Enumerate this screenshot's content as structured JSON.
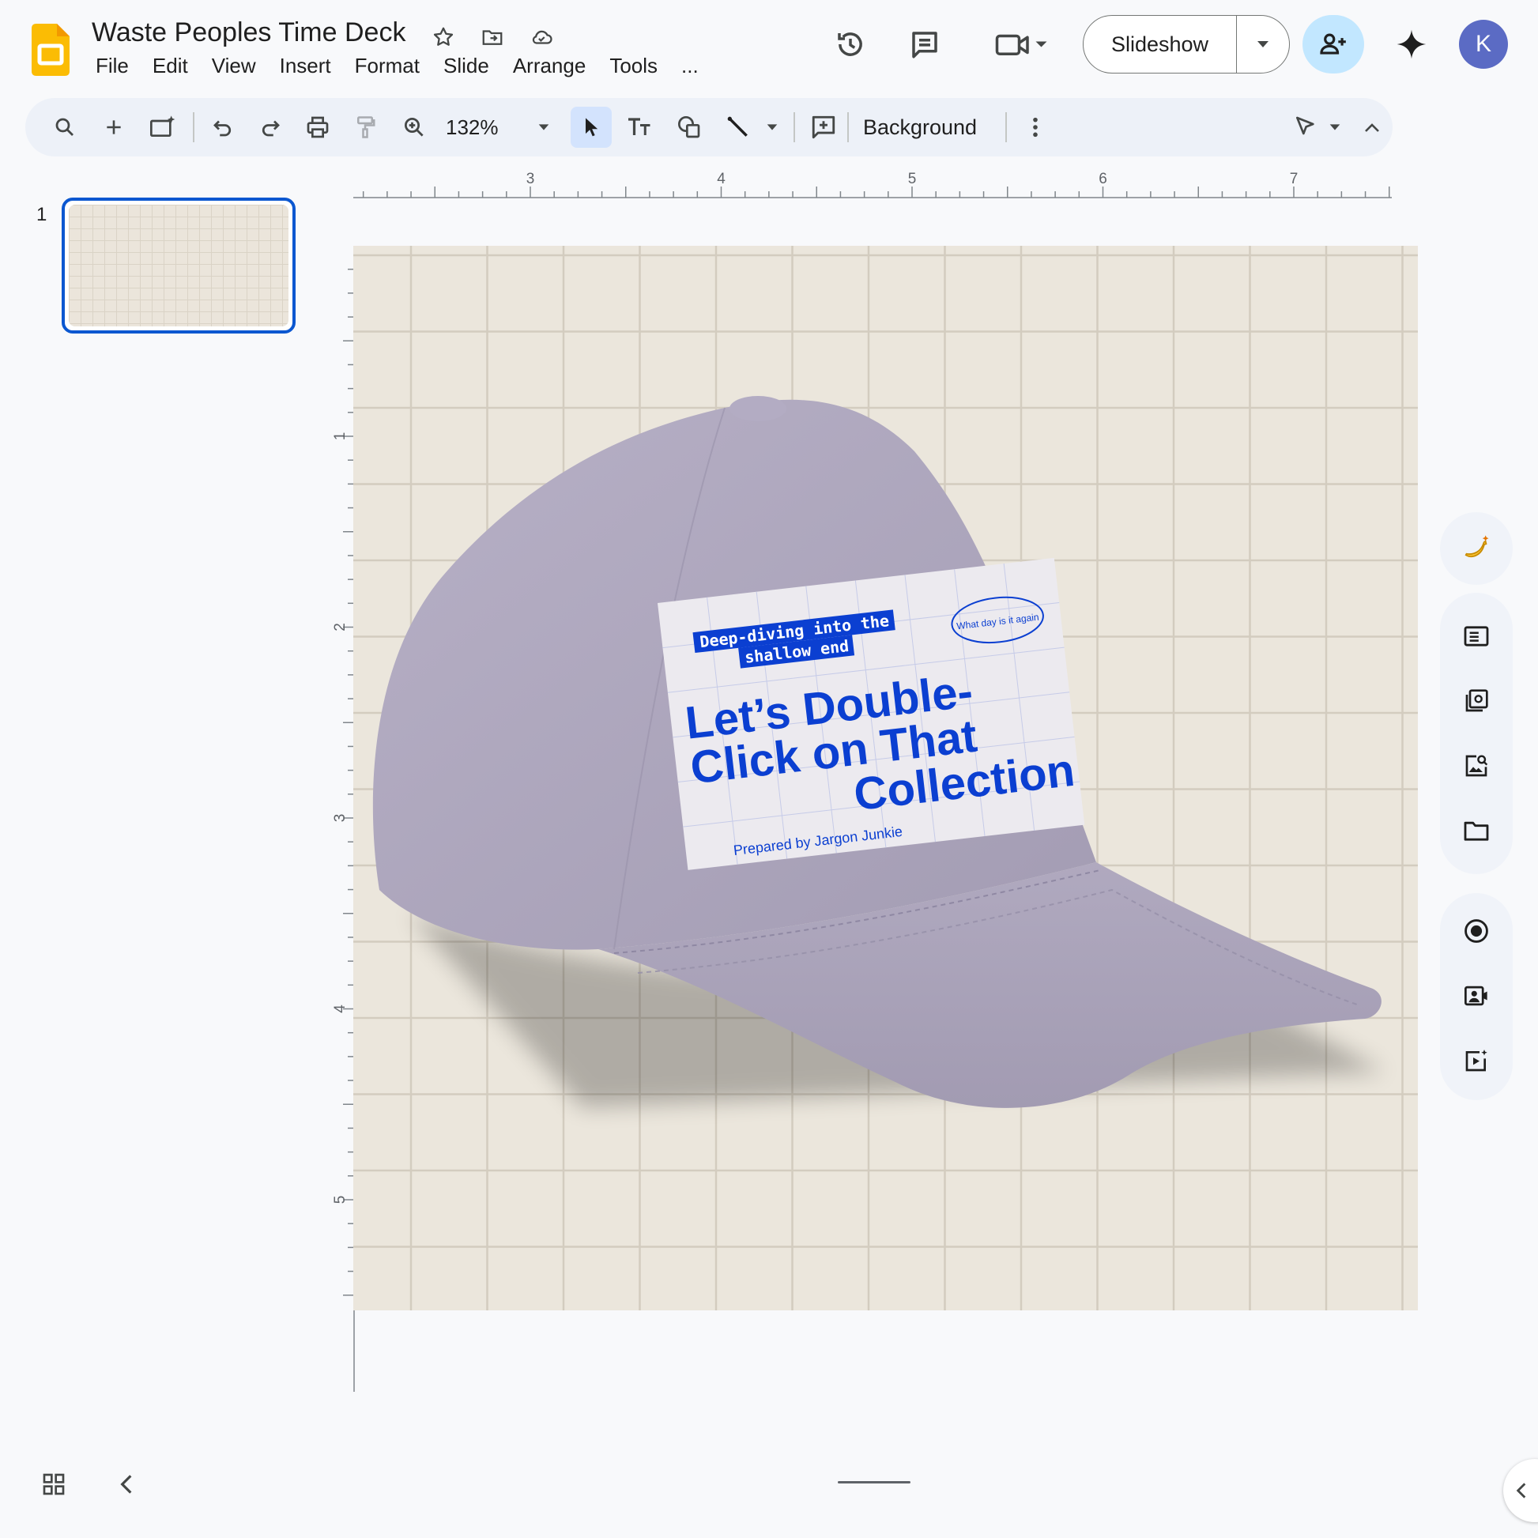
{
  "app": {
    "doc_title": "Waste Peoples Time Deck"
  },
  "menu": [
    "File",
    "Edit",
    "View",
    "Insert",
    "Format",
    "Slide",
    "Arrange",
    "Tools",
    "..."
  ],
  "header": {
    "slideshow_label": "Slideshow",
    "avatar_initial": "K"
  },
  "toolbar": {
    "zoom": "132%",
    "background_label": "Background"
  },
  "filmstrip": {
    "slides": [
      {
        "number": "1"
      }
    ]
  },
  "ruler": {
    "horizontal": [
      "3",
      "4",
      "5",
      "6",
      "7"
    ],
    "vertical": [
      "1",
      "2",
      "3",
      "4",
      "5"
    ]
  },
  "slide_content": {
    "tagline": [
      "Deep-diving into the",
      "shallow end"
    ],
    "badge": "What day is it again",
    "headline": [
      "Let’s Double-",
      "Click on That",
      "Collection"
    ],
    "byline": "Prepared by Jargon Junkie"
  },
  "colors": {
    "accent_blue": "#0b3fd1",
    "cap_lavender": "#ada6bd",
    "slide_bg": "#ebe6dc",
    "selection_blue": "#0b57d0",
    "share_button": "#c2e7ff",
    "avatar": "#5b6bc4"
  },
  "icons": {
    "header": [
      "version-history-icon",
      "comment-icon",
      "meet-icon",
      "share-icon",
      "gemini-icon"
    ],
    "side_panel": [
      "banana-icon",
      "slides-icon",
      "gallery-icon",
      "image-search-icon",
      "folder-icon",
      "record-icon",
      "camera-icon",
      "video-add-icon"
    ]
  }
}
